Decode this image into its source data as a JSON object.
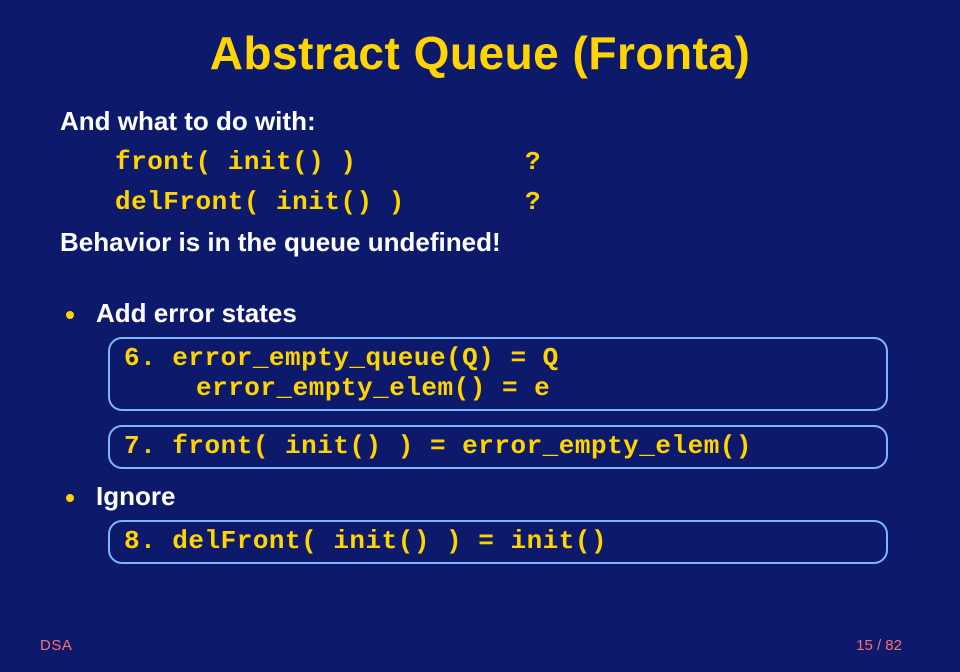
{
  "title": "Abstract Queue (Fronta)",
  "intro": "And what to do with:",
  "rows": [
    {
      "lhs": "front( init() )",
      "rhs": "?"
    },
    {
      "lhs": "delFront( init() )",
      "rhs": "?"
    }
  ],
  "behavior": "Behavior is in the queue undefined!",
  "bullets": {
    "add_error": "Add error states",
    "ignore": "Ignore"
  },
  "boxes": {
    "b1_line1": "6. error_empty_queue(Q) = Q",
    "b1_line2": "error_empty_elem() = e",
    "b2_line1": "7. front( init() ) = error_empty_elem()",
    "b3_line1": "8. delFront( init() ) = init()"
  },
  "footer": {
    "left": "DSA",
    "right": "15 / 82"
  }
}
